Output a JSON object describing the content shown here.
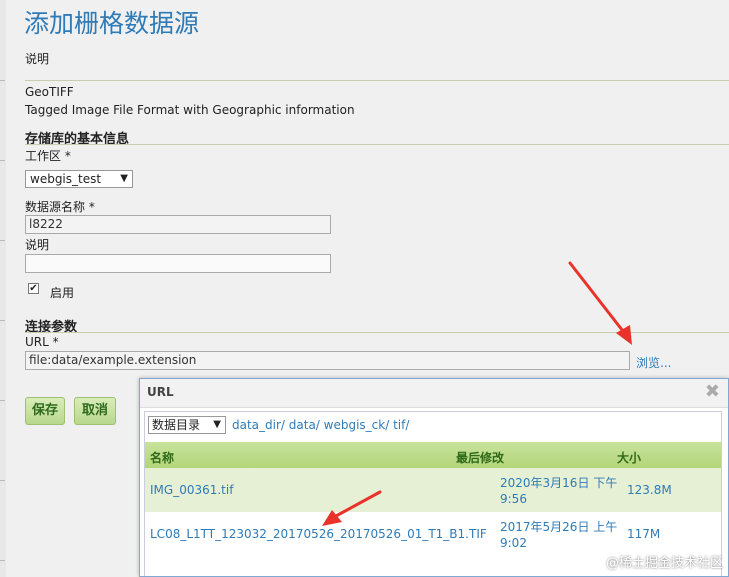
{
  "page": {
    "title": "添加栅格数据源",
    "description_label": "说明",
    "format_name": "GeoTIFF",
    "format_desc": "Tagged Image File Format with Geographic information"
  },
  "store_info": {
    "heading": "存储库的基本信息",
    "workspace_label": "工作区 *",
    "workspace_value": "webgis_test",
    "name_label": "数据源名称 *",
    "name_value": "l8222",
    "desc_label": "说明",
    "desc_value": "",
    "enabled_label": "启用",
    "enabled": true
  },
  "connection": {
    "heading": "连接参数",
    "url_label": "URL *",
    "url_value": "file:data/example.extension",
    "browse_label": "浏览..."
  },
  "buttons": {
    "save": "保存",
    "cancel": "取消"
  },
  "modal": {
    "title": "URL",
    "close_glyph": "✖",
    "dir_select": "数据目录",
    "breadcrumb": "data_dir/ data/ webgis_ck/ tif/",
    "columns": [
      "名称",
      "最后修改",
      "大小"
    ],
    "rows": [
      {
        "name": "IMG_00361.tif",
        "modified_line1": "2020年3月16日 下午",
        "modified_line2": "9:56",
        "size": "123.8M"
      },
      {
        "name": "LC08_L1TT_123032_20170526_20170526_01_T1_B1.TIF",
        "modified_line1": "2017年5月26日 上午",
        "modified_line2": "9:02",
        "size": "117M"
      }
    ]
  },
  "watermark": "@稀土掘金技术社区",
  "colors": {
    "title_blue": "#2e7bb8",
    "button_green": "#b8d88e",
    "header_green": "#b3d57a",
    "arrow_red": "#e8322a"
  }
}
